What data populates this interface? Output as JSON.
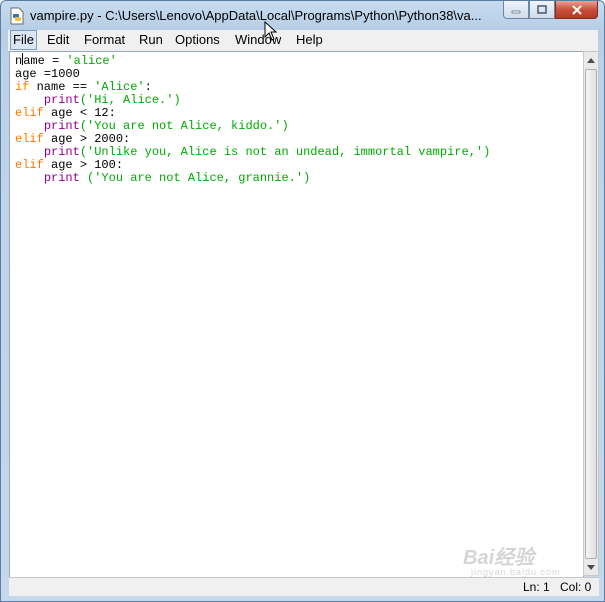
{
  "window": {
    "title": "vampire.py - C:\\Users\\Lenovo\\AppData\\Local\\Programs\\Python\\Python38\\va..."
  },
  "menu": {
    "file": "File",
    "edit": "Edit",
    "format": "Format",
    "run": "Run",
    "options": "Options",
    "window": "Window",
    "help": "Help"
  },
  "code": {
    "l1_a": "ame = ",
    "l1_first": "n",
    "l1_s": "'alice'",
    "l2": "age =1000",
    "l3_kw": "if",
    "l3_mid": " name == ",
    "l3_s": "'Alice'",
    "l3_end": ":",
    "l4_pre": "    ",
    "l4_fn": "print",
    "l4_s": "('Hi, Alice.')",
    "l5_kw": "elif",
    "l5_rest": " age < 12:",
    "l6_fn": "print",
    "l6_s": "('You are not Alice, kiddo.')",
    "l7_kw": "elif",
    "l7_rest": " age > 2000:",
    "l8_fn": "print",
    "l8_s": "('Unlike you, Alice is not an undead, immortal vampire,')",
    "l9_kw": "elif",
    "l9_rest": " age > 100:",
    "l10_fn": "print",
    "l10_s": " ('You are not Alice, grannie.')"
  },
  "status": {
    "ln": "Ln: 1",
    "col": "Col: 0"
  },
  "watermark": {
    "text": "Bai经验",
    "sub": "jingyan.baidu.com"
  },
  "colors": {
    "keyword": "#ff7700",
    "builtin": "#900090",
    "string": "#00aa00",
    "title_bar": "#bcd2e8",
    "close_button": "#c9503c"
  }
}
